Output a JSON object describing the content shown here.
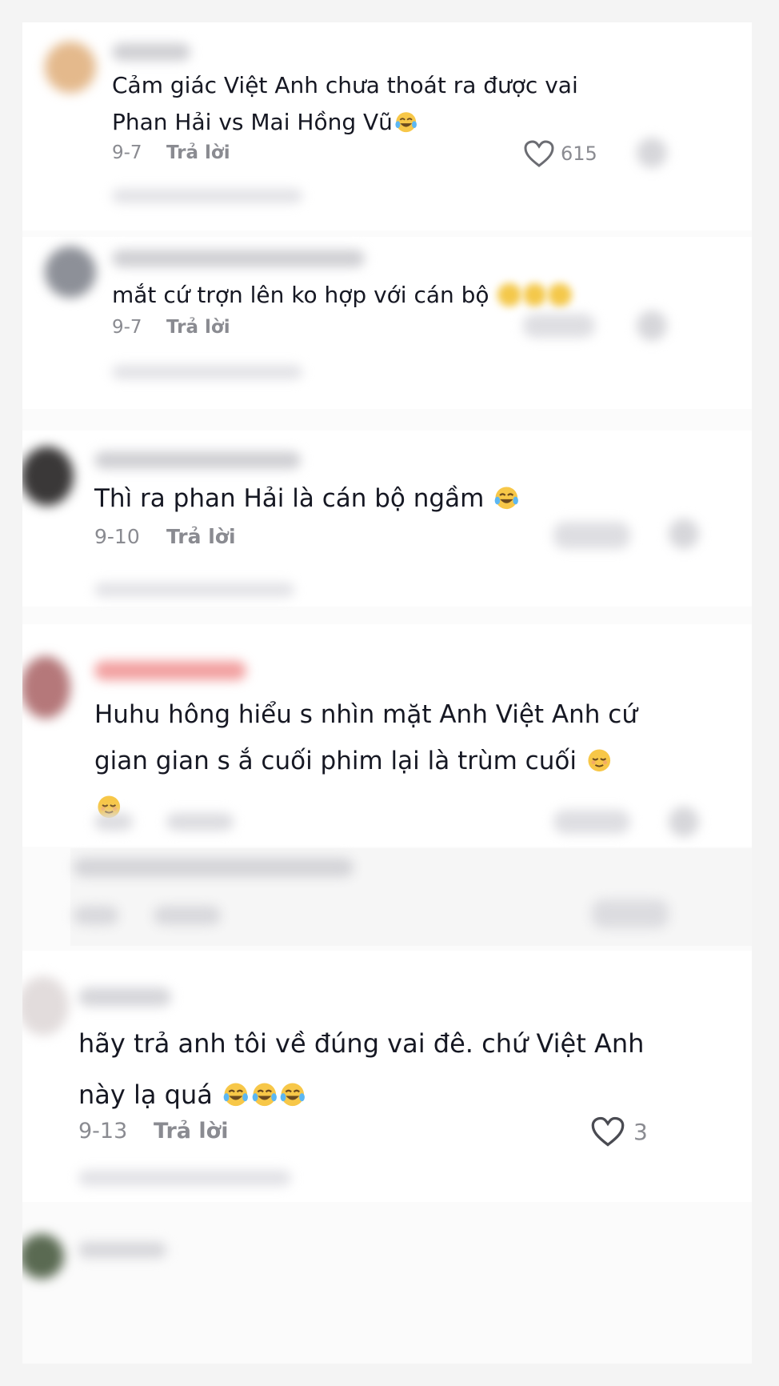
{
  "comments": [
    {
      "lines": [
        "Cảm giác Việt Anh chưa thoát ra được vai",
        "Phan Hải vs Mai Hồng Vũ"
      ],
      "date": "9-7",
      "reply_label": "Trả lời",
      "likes": "615",
      "emoji": [
        "tears-of-joy-emoji"
      ]
    },
    {
      "lines": [
        "mắt cứ trợn lên ko hợp với cán bộ"
      ],
      "date": "9-7",
      "reply_label": "Trả lời",
      "emoji": [
        "blurred-emoji",
        "blurred-emoji",
        "blurred-emoji"
      ]
    },
    {
      "lines": [
        "Thì ra phan Hải là cán bộ ngầm"
      ],
      "date": "9-10",
      "reply_label": "Trả lời",
      "emoji": [
        "tears-of-joy-emoji"
      ]
    },
    {
      "lines": [
        "Huhu hông hiểu s nhìn mặt Anh Việt Anh cứ",
        "gian gian s ắ cuối phim lại là trùm cuối"
      ],
      "emoji": [
        "relieved-face-emoji",
        "relieved-face-emoji"
      ]
    },
    {
      "lines": [
        "hãy trả anh tôi về đúng vai đê. chứ Việt Anh",
        "này lạ quá"
      ],
      "date": "9-13",
      "reply_label": "Trả lời",
      "likes": "3",
      "emoji": [
        "tears-of-joy-emoji",
        "tears-of-joy-emoji",
        "tears-of-joy-emoji"
      ]
    }
  ],
  "colors": {
    "text": "#161823",
    "muted": "#8a8b91",
    "background": "#ffffff"
  }
}
